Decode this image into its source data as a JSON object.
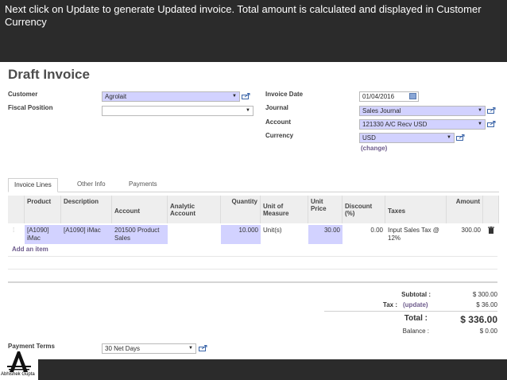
{
  "banner": {
    "text": "Next click on Update to generate Updated invoice. Total amount is calculated and displayed in Customer Currency"
  },
  "form": {
    "title": "Draft Invoice",
    "customer_label": "Customer",
    "customer_value": "Agrolait",
    "fiscal_position_label": "Fiscal Position",
    "fiscal_position_value": "",
    "invoice_date_label": "Invoice Date",
    "invoice_date_value": "01/04/2016",
    "journal_label": "Journal",
    "journal_value": "Sales Journal",
    "account_label": "Account",
    "account_value": "121330 A/C Recv USD",
    "currency_label": "Currency",
    "currency_value": "USD",
    "change_link": "(change)"
  },
  "tabs": [
    "Invoice Lines",
    "Other Info",
    "Payments"
  ],
  "table": {
    "headers": {
      "product": "Product",
      "description": "Description",
      "account": "Account",
      "analytic": "Analytic Account",
      "quantity": "Quantity",
      "uom": "Unit of Measure",
      "unit_price": "Unit Price",
      "discount": "Discount (%)",
      "taxes": "Taxes",
      "amount": "Amount"
    },
    "row": {
      "product": "[A1090] iMac",
      "description": "[A1090] iMac",
      "account": "201500 Product Sales",
      "analytic": "",
      "quantity": "10.000",
      "uom": "Unit(s)",
      "unit_price": "30.00",
      "discount": "0.00",
      "taxes": "Input Sales Tax @ 12%",
      "amount": "300.00"
    },
    "add_item": "Add an item"
  },
  "totals": {
    "subtotal_label": "Subtotal :",
    "subtotal_value": "$ 300.00",
    "tax_label": "Tax :",
    "update_link": "(update)",
    "tax_value": "$ 36.00",
    "total_label": "Total :",
    "total_value": "$ 336.00",
    "balance_label": "Balance :",
    "balance_value": "$ 0.00"
  },
  "payment": {
    "terms_label": "Payment Terms",
    "terms_value": "30 Net Days"
  },
  "author": {
    "name": "Abhishek Gupta"
  },
  "icons": {
    "external": "external-link-icon",
    "calendar": "calendar-icon",
    "trash": "trash-icon",
    "dropdown": "chevron-down-icon"
  },
  "colors": {
    "required_field": "#d2d2ff",
    "banner": "#2b2b2b",
    "link": "#6d5b8c"
  }
}
